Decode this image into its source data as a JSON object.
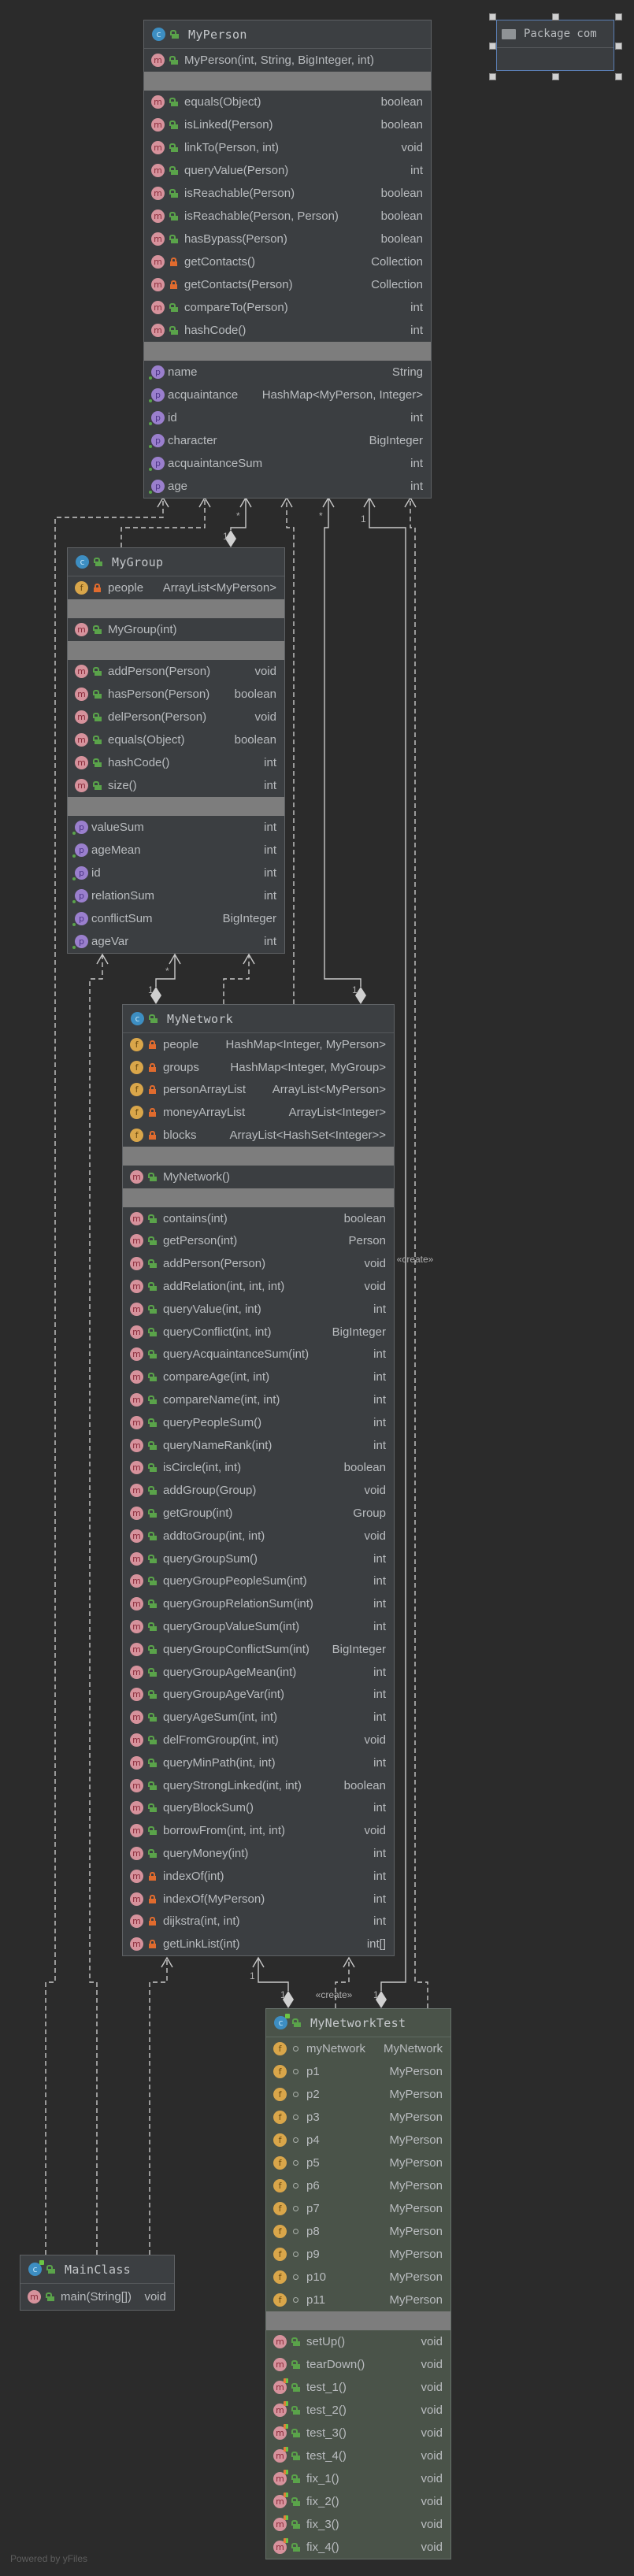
{
  "package": {
    "title": "Package com",
    "icon": "folder-icon"
  },
  "classes": {
    "myPerson": {
      "name": "MyPerson",
      "kind": "class",
      "sections": [
        {
          "kind": "constructors",
          "rows": [
            {
              "icon": "m",
              "vis": "public",
              "name": "MyPerson(int, String, BigInteger, int)",
              "type": ""
            }
          ]
        },
        {
          "kind": "methods",
          "rows": [
            {
              "icon": "m",
              "vis": "public",
              "name": "equals(Object)",
              "type": "boolean"
            },
            {
              "icon": "m",
              "vis": "public",
              "name": "isLinked(Person)",
              "type": "boolean"
            },
            {
              "icon": "m",
              "vis": "public",
              "name": "linkTo(Person, int)",
              "type": "void"
            },
            {
              "icon": "m",
              "vis": "public",
              "name": "queryValue(Person)",
              "type": "int"
            },
            {
              "icon": "m",
              "vis": "public",
              "name": "isReachable(Person)",
              "type": "boolean"
            },
            {
              "icon": "m",
              "vis": "public",
              "name": "isReachable(Person, Person)",
              "type": "boolean"
            },
            {
              "icon": "m",
              "vis": "public",
              "name": "hasBypass(Person)",
              "type": "boolean"
            },
            {
              "icon": "m",
              "vis": "private",
              "name": "getContacts()",
              "type": "Collection"
            },
            {
              "icon": "m",
              "vis": "private",
              "name": "getContacts(Person)",
              "type": "Collection"
            },
            {
              "icon": "m",
              "vis": "public",
              "name": "compareTo(Person)",
              "type": "int"
            },
            {
              "icon": "m",
              "vis": "public",
              "name": "hashCode()",
              "type": "int"
            }
          ]
        },
        {
          "kind": "properties",
          "rows": [
            {
              "icon": "p",
              "name": "name",
              "type": "String"
            },
            {
              "icon": "p",
              "name": "acquaintance",
              "type": "HashMap<MyPerson, Integer>"
            },
            {
              "icon": "p",
              "name": "id",
              "type": "int"
            },
            {
              "icon": "p",
              "name": "character",
              "type": "BigInteger"
            },
            {
              "icon": "p",
              "name": "acquaintanceSum",
              "type": "int"
            },
            {
              "icon": "p",
              "name": "age",
              "type": "int"
            }
          ]
        }
      ]
    },
    "myGroup": {
      "name": "MyGroup",
      "kind": "class",
      "sections": [
        {
          "kind": "fields",
          "rows": [
            {
              "icon": "f",
              "vis": "private",
              "name": "people",
              "type": "ArrayList<MyPerson>"
            }
          ]
        },
        {
          "kind": "constructors",
          "rows": [
            {
              "icon": "m",
              "vis": "public",
              "name": "MyGroup(int)",
              "type": ""
            }
          ]
        },
        {
          "kind": "methods",
          "rows": [
            {
              "icon": "m",
              "vis": "public",
              "name": "addPerson(Person)",
              "type": "void"
            },
            {
              "icon": "m",
              "vis": "public",
              "name": "hasPerson(Person)",
              "type": "boolean"
            },
            {
              "icon": "m",
              "vis": "public",
              "name": "delPerson(Person)",
              "type": "void"
            },
            {
              "icon": "m",
              "vis": "public",
              "name": "equals(Object)",
              "type": "boolean"
            },
            {
              "icon": "m",
              "vis": "public",
              "name": "hashCode()",
              "type": "int"
            },
            {
              "icon": "m",
              "vis": "public",
              "name": "size()",
              "type": "int"
            }
          ]
        },
        {
          "kind": "properties",
          "rows": [
            {
              "icon": "p",
              "name": "valueSum",
              "type": "int"
            },
            {
              "icon": "p",
              "name": "ageMean",
              "type": "int"
            },
            {
              "icon": "p",
              "name": "id",
              "type": "int"
            },
            {
              "icon": "p",
              "name": "relationSum",
              "type": "int"
            },
            {
              "icon": "p",
              "name": "conflictSum",
              "type": "BigInteger"
            },
            {
              "icon": "p",
              "name": "ageVar",
              "type": "int"
            }
          ]
        }
      ]
    },
    "myNetwork": {
      "name": "MyNetwork",
      "kind": "class",
      "sections": [
        {
          "kind": "fields",
          "rows": [
            {
              "icon": "f",
              "vis": "private",
              "name": "people",
              "type": "HashMap<Integer, MyPerson>"
            },
            {
              "icon": "f",
              "vis": "private",
              "name": "groups",
              "type": "HashMap<Integer, MyGroup>"
            },
            {
              "icon": "f",
              "vis": "private",
              "name": "personArrayList",
              "type": "ArrayList<MyPerson>"
            },
            {
              "icon": "f",
              "vis": "private",
              "name": "moneyArrayList",
              "type": "ArrayList<Integer>"
            },
            {
              "icon": "f",
              "vis": "private",
              "name": "blocks",
              "type": "ArrayList<HashSet<Integer>>"
            }
          ]
        },
        {
          "kind": "constructors",
          "rows": [
            {
              "icon": "m",
              "vis": "public",
              "name": "MyNetwork()",
              "type": ""
            }
          ]
        },
        {
          "kind": "methods",
          "rows": [
            {
              "icon": "m",
              "vis": "public",
              "name": "contains(int)",
              "type": "boolean"
            },
            {
              "icon": "m",
              "vis": "public",
              "name": "getPerson(int)",
              "type": "Person"
            },
            {
              "icon": "m",
              "vis": "public",
              "name": "addPerson(Person)",
              "type": "void"
            },
            {
              "icon": "m",
              "vis": "public",
              "name": "addRelation(int, int, int)",
              "type": "void"
            },
            {
              "icon": "m",
              "vis": "public",
              "name": "queryValue(int, int)",
              "type": "int"
            },
            {
              "icon": "m",
              "vis": "public",
              "name": "queryConflict(int, int)",
              "type": "BigInteger"
            },
            {
              "icon": "m",
              "vis": "public",
              "name": "queryAcquaintanceSum(int)",
              "type": "int"
            },
            {
              "icon": "m",
              "vis": "public",
              "name": "compareAge(int, int)",
              "type": "int"
            },
            {
              "icon": "m",
              "vis": "public",
              "name": "compareName(int, int)",
              "type": "int"
            },
            {
              "icon": "m",
              "vis": "public",
              "name": "queryPeopleSum()",
              "type": "int"
            },
            {
              "icon": "m",
              "vis": "public",
              "name": "queryNameRank(int)",
              "type": "int"
            },
            {
              "icon": "m",
              "vis": "public",
              "name": "isCircle(int, int)",
              "type": "boolean"
            },
            {
              "icon": "m",
              "vis": "public",
              "name": "addGroup(Group)",
              "type": "void"
            },
            {
              "icon": "m",
              "vis": "public",
              "name": "getGroup(int)",
              "type": "Group"
            },
            {
              "icon": "m",
              "vis": "public",
              "name": "addtoGroup(int, int)",
              "type": "void"
            },
            {
              "icon": "m",
              "vis": "public",
              "name": "queryGroupSum()",
              "type": "int"
            },
            {
              "icon": "m",
              "vis": "public",
              "name": "queryGroupPeopleSum(int)",
              "type": "int"
            },
            {
              "icon": "m",
              "vis": "public",
              "name": "queryGroupRelationSum(int)",
              "type": "int"
            },
            {
              "icon": "m",
              "vis": "public",
              "name": "queryGroupValueSum(int)",
              "type": "int"
            },
            {
              "icon": "m",
              "vis": "public",
              "name": "queryGroupConflictSum(int)",
              "type": "BigInteger"
            },
            {
              "icon": "m",
              "vis": "public",
              "name": "queryGroupAgeMean(int)",
              "type": "int"
            },
            {
              "icon": "m",
              "vis": "public",
              "name": "queryGroupAgeVar(int)",
              "type": "int"
            },
            {
              "icon": "m",
              "vis": "public",
              "name": "queryAgeSum(int, int)",
              "type": "int"
            },
            {
              "icon": "m",
              "vis": "public",
              "name": "delFromGroup(int, int)",
              "type": "void"
            },
            {
              "icon": "m",
              "vis": "public",
              "name": "queryMinPath(int, int)",
              "type": "int"
            },
            {
              "icon": "m",
              "vis": "public",
              "name": "queryStrongLinked(int, int)",
              "type": "boolean"
            },
            {
              "icon": "m",
              "vis": "public",
              "name": "queryBlockSum()",
              "type": "int"
            },
            {
              "icon": "m",
              "vis": "public",
              "name": "borrowFrom(int, int, int)",
              "type": "void"
            },
            {
              "icon": "m",
              "vis": "public",
              "name": "queryMoney(int)",
              "type": "int"
            },
            {
              "icon": "m",
              "vis": "private",
              "name": "indexOf(int)",
              "type": "int"
            },
            {
              "icon": "m",
              "vis": "private",
              "name": "indexOf(MyPerson)",
              "type": "int"
            },
            {
              "icon": "m",
              "vis": "private",
              "name": "dijkstra(int, int)",
              "type": "int"
            },
            {
              "icon": "m",
              "vis": "private",
              "name": "getLinkList(int)",
              "type": "int[]"
            }
          ]
        }
      ]
    },
    "myNetworkTest": {
      "name": "MyNetworkTest",
      "kind": "test-class",
      "sections": [
        {
          "kind": "fields",
          "rows": [
            {
              "icon": "f",
              "vis": "package",
              "name": "myNetwork",
              "type": "MyNetwork"
            },
            {
              "icon": "f",
              "vis": "package",
              "name": "p1",
              "type": "MyPerson"
            },
            {
              "icon": "f",
              "vis": "package",
              "name": "p2",
              "type": "MyPerson"
            },
            {
              "icon": "f",
              "vis": "package",
              "name": "p3",
              "type": "MyPerson"
            },
            {
              "icon": "f",
              "vis": "package",
              "name": "p4",
              "type": "MyPerson"
            },
            {
              "icon": "f",
              "vis": "package",
              "name": "p5",
              "type": "MyPerson"
            },
            {
              "icon": "f",
              "vis": "package",
              "name": "p6",
              "type": "MyPerson"
            },
            {
              "icon": "f",
              "vis": "package",
              "name": "p7",
              "type": "MyPerson"
            },
            {
              "icon": "f",
              "vis": "package",
              "name": "p8",
              "type": "MyPerson"
            },
            {
              "icon": "f",
              "vis": "package",
              "name": "p9",
              "type": "MyPerson"
            },
            {
              "icon": "f",
              "vis": "package",
              "name": "p10",
              "type": "MyPerson"
            },
            {
              "icon": "f",
              "vis": "package",
              "name": "p11",
              "type": "MyPerson"
            }
          ]
        },
        {
          "kind": "methods",
          "rows": [
            {
              "icon": "m",
              "vis": "public",
              "name": "setUp()",
              "type": "void"
            },
            {
              "icon": "m",
              "vis": "public",
              "name": "tearDown()",
              "type": "void"
            },
            {
              "icon": "m",
              "vis": "public",
              "name": "test_1()",
              "type": "void",
              "test": true
            },
            {
              "icon": "m",
              "vis": "public",
              "name": "test_2()",
              "type": "void",
              "test": true
            },
            {
              "icon": "m",
              "vis": "public",
              "name": "test_3()",
              "type": "void",
              "test": true
            },
            {
              "icon": "m",
              "vis": "public",
              "name": "test_4()",
              "type": "void",
              "test": true
            },
            {
              "icon": "m",
              "vis": "public",
              "name": "fix_1()",
              "type": "void",
              "test": true
            },
            {
              "icon": "m",
              "vis": "public",
              "name": "fix_2()",
              "type": "void",
              "test": true
            },
            {
              "icon": "m",
              "vis": "public",
              "name": "fix_3()",
              "type": "void",
              "test": true
            },
            {
              "icon": "m",
              "vis": "public",
              "name": "fix_4()",
              "type": "void",
              "test": true
            }
          ]
        }
      ]
    },
    "mainClass": {
      "name": "MainClass",
      "kind": "runnable-class",
      "sections": [
        {
          "kind": "methods",
          "rows": [
            {
              "icon": "m",
              "vis": "public",
              "name": "main(String[])",
              "type": "void"
            }
          ]
        }
      ]
    }
  },
  "relations": [
    {
      "from": "MainClass",
      "to": "MyPerson",
      "kind": "dependency"
    },
    {
      "from": "MyGroup",
      "to": "MyPerson",
      "kind": "dependency"
    },
    {
      "from": "MyGroup",
      "to": "MyPerson",
      "kind": "composition",
      "source_mult": "1",
      "target_mult": "*"
    },
    {
      "from": "MyNetwork",
      "to": "MyPerson",
      "kind": "dependency"
    },
    {
      "from": "MyNetwork",
      "to": "MyPerson",
      "kind": "composition",
      "source_mult": "1",
      "target_mult": "*"
    },
    {
      "from": "MyNetworkTest",
      "to": "MyPerson",
      "kind": "composition",
      "source_mult": "1",
      "target_mult": "1"
    },
    {
      "from": "MyNetworkTest",
      "to": "MyPerson",
      "kind": "dependency",
      "stereotype": "«create»"
    },
    {
      "from": "MainClass",
      "to": "MyGroup",
      "kind": "dependency"
    },
    {
      "from": "MyNetwork",
      "to": "MyGroup",
      "kind": "composition",
      "source_mult": "1",
      "target_mult": "*"
    },
    {
      "from": "MyNetwork",
      "to": "MyGroup",
      "kind": "dependency"
    },
    {
      "from": "MainClass",
      "to": "MyNetwork",
      "kind": "dependency"
    },
    {
      "from": "MyNetworkTest",
      "to": "MyNetwork",
      "kind": "composition",
      "source_mult": "1",
      "target_mult": "1"
    },
    {
      "from": "MyNetworkTest",
      "to": "MyNetwork",
      "kind": "dependency",
      "stereotype": "«create»"
    }
  ],
  "footer": "Powered by yFiles",
  "colors": {
    "background": "#2b2b2b",
    "class_box": "#3b3e41",
    "test_box": "#4a5349",
    "band": "#7d7d7d",
    "selection": "#5b7fb5"
  }
}
